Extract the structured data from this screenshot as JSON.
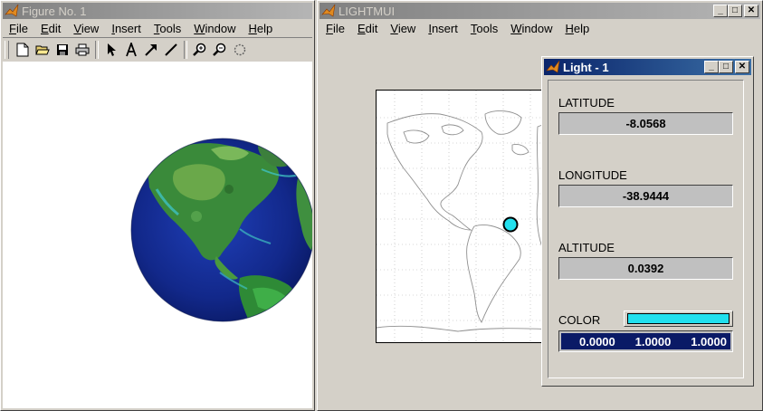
{
  "figure_window": {
    "title": "Figure No. 1",
    "menu": [
      "File",
      "Edit",
      "View",
      "Insert",
      "Tools",
      "Window",
      "Help"
    ],
    "toolbar_icons": [
      "new-file-icon",
      "open-folder-icon",
      "save-icon",
      "print-icon",
      "select-arrow-icon",
      "text-icon",
      "arrow-icon",
      "line-icon",
      "zoom-in-icon",
      "zoom-out-icon",
      "rotate-icon"
    ]
  },
  "lightmui_window": {
    "title": "LIGHTMUI",
    "menu": [
      "File",
      "Edit",
      "View",
      "Insert",
      "Tools",
      "Window",
      "Help"
    ],
    "title_buttons": [
      "_",
      "□",
      "✕"
    ]
  },
  "light_dialog": {
    "title": "Light - 1",
    "latitude_label": "LATITUDE",
    "latitude_value": "-8.0568",
    "longitude_label": "LONGITUDE",
    "longitude_value": "-38.9444",
    "altitude_label": "ALTITUDE",
    "altitude_value": "0.0392",
    "color_label": "COLOR",
    "color_swatch": "#22e0ee",
    "color_values": [
      "0.0000",
      "1.0000",
      "1.0000"
    ]
  },
  "colors": {
    "light_marker": "#22e0ee",
    "active_title": "#0a246a",
    "inactive_title": "#808080"
  }
}
